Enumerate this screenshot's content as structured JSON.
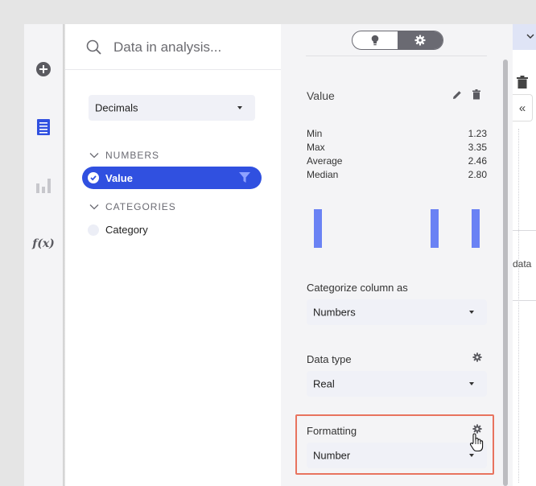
{
  "sidebar": {
    "icons": [
      "plus-circle-icon",
      "data-table-icon",
      "visualization-bars-icon",
      "function-fx-icon"
    ],
    "fx_label": "f(x)"
  },
  "search": {
    "placeholder": "Data in analysis..."
  },
  "dataset_dropdown": {
    "value": "Decimals"
  },
  "groups": [
    {
      "header": "NUMBERS",
      "items": [
        {
          "label": "Value",
          "selected": true
        }
      ]
    },
    {
      "header": "CATEGORIES",
      "items": [
        {
          "label": "Category",
          "selected": false
        }
      ]
    }
  ],
  "details": {
    "toggle": {
      "left_icon": "lightbulb-icon",
      "right_icon": "gear-icon",
      "active": "right"
    },
    "column_title": "Value",
    "stats": [
      {
        "label": "Min",
        "value": "1.23"
      },
      {
        "label": "Max",
        "value": "3.35"
      },
      {
        "label": "Average",
        "value": "2.46"
      },
      {
        "label": "Median",
        "value": "2.80"
      }
    ],
    "histogram": [
      1.23,
      2.8,
      3.35
    ],
    "histogram_range": [
      1.23,
      3.35
    ],
    "categorize": {
      "label": "Categorize column as",
      "value": "Numbers"
    },
    "data_type": {
      "label": "Data type",
      "value": "Real"
    },
    "formatting": {
      "label": "Formatting",
      "value": "Number"
    }
  },
  "canvas": {
    "collapse_label": "«",
    "partial_text": "data"
  },
  "colors": {
    "accent": "#3050e0",
    "histogram": "#6a82f4",
    "highlight_border": "#e8735e"
  }
}
